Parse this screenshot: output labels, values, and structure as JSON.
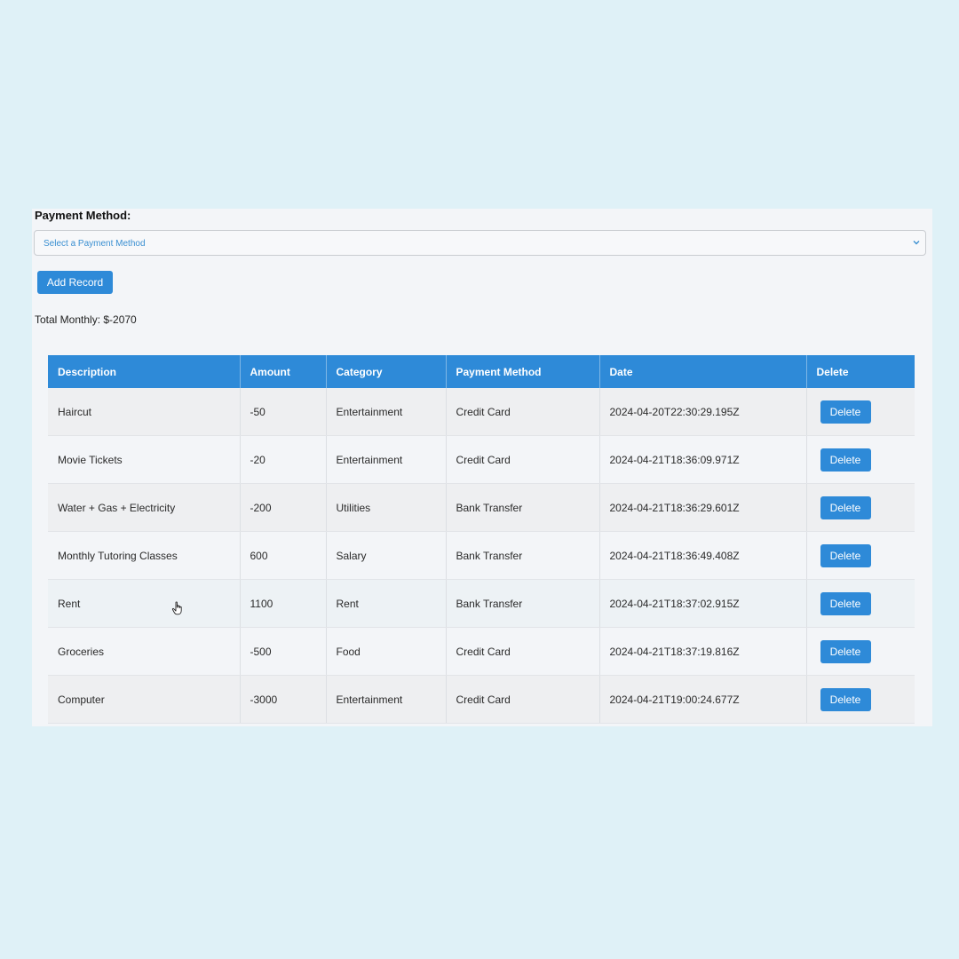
{
  "form": {
    "payment_method_label": "Payment Method:",
    "payment_method_placeholder": "Select a Payment Method",
    "add_button_label": "Add Record",
    "total_text": "Total Monthly: $-2070"
  },
  "table": {
    "headers": [
      "Description",
      "Amount",
      "Category",
      "Payment Method",
      "Date",
      "Delete"
    ],
    "rows": [
      {
        "description": "Haircut",
        "amount": "-50",
        "category": "Entertainment",
        "payment_method": "Credit Card",
        "date": "2024-04-20T22:30:29.195Z",
        "delete_label": "Delete"
      },
      {
        "description": "Movie Tickets",
        "amount": "-20",
        "category": "Entertainment",
        "payment_method": "Credit Card",
        "date": "2024-04-21T18:36:09.971Z",
        "delete_label": "Delete"
      },
      {
        "description": "Water + Gas + Electricity",
        "amount": "-200",
        "category": "Utilities",
        "payment_method": "Bank Transfer",
        "date": "2024-04-21T18:36:29.601Z",
        "delete_label": "Delete"
      },
      {
        "description": "Monthly Tutoring Classes",
        "amount": "600",
        "category": "Salary",
        "payment_method": "Bank Transfer",
        "date": "2024-04-21T18:36:49.408Z",
        "delete_label": "Delete"
      },
      {
        "description": "Rent",
        "amount": "1100",
        "category": "Rent",
        "payment_method": "Bank Transfer",
        "date": "2024-04-21T18:37:02.915Z",
        "delete_label": "Delete"
      },
      {
        "description": "Groceries",
        "amount": "-500",
        "category": "Food",
        "payment_method": "Credit Card",
        "date": "2024-04-21T18:37:19.816Z",
        "delete_label": "Delete"
      },
      {
        "description": "Computer",
        "amount": "-3000",
        "category": "Entertainment",
        "payment_method": "Credit Card",
        "date": "2024-04-21T19:00:24.677Z",
        "delete_label": "Delete"
      }
    ]
  },
  "colors": {
    "accent": "#2e8ad8",
    "background": "#dff1f7",
    "panel": "#f3f5f8"
  },
  "icons": {
    "select_chevron": "chevron-down-icon",
    "cursor": "hand-pointer-icon"
  }
}
